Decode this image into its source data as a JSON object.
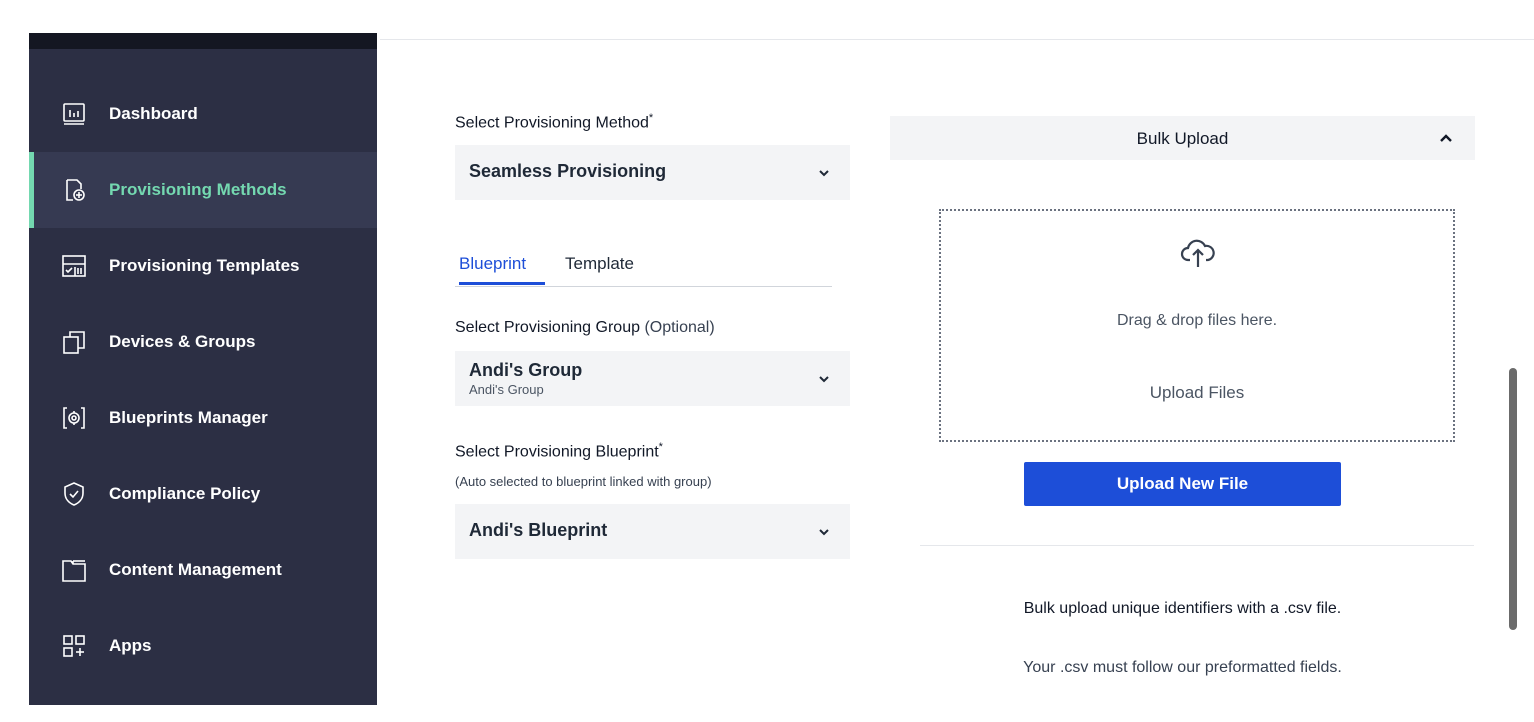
{
  "sidebar": {
    "items": [
      {
        "label": "Dashboard",
        "icon": "dashboard-icon",
        "active": false
      },
      {
        "label": "Provisioning Methods",
        "icon": "provisioning-methods-icon",
        "active": true
      },
      {
        "label": "Provisioning Templates",
        "icon": "templates-icon",
        "active": false
      },
      {
        "label": "Devices & Groups",
        "icon": "devices-icon",
        "active": false
      },
      {
        "label": "Blueprints Manager",
        "icon": "blueprints-icon",
        "active": false
      },
      {
        "label": "Compliance Policy",
        "icon": "shield-check-icon",
        "active": false
      },
      {
        "label": "Content Management",
        "icon": "folder-icon",
        "active": false
      },
      {
        "label": "Apps",
        "icon": "apps-grid-icon",
        "active": false
      }
    ]
  },
  "form": {
    "method_label": "Select Provisioning Method",
    "required_mark": "*",
    "method_value": "Seamless Provisioning",
    "tabs": [
      "Blueprint",
      "Template"
    ],
    "active_tab": "Blueprint",
    "group_label": "Select Provisioning Group",
    "group_optional": "(Optional)",
    "group_value": "Andi's Group",
    "group_sub": "Andi's Group",
    "blueprint_label": "Select Provisioning Blueprint",
    "blueprint_hint": "(Auto selected to blueprint linked with group)",
    "blueprint_value": "Andi's Blueprint"
  },
  "bulk": {
    "header": "Bulk Upload",
    "drag_text": "Drag & drop files here.",
    "upload_files": "Upload Files",
    "upload_button": "Upload New File",
    "info_line1": "Bulk upload unique identifiers with a .csv file.",
    "info_line2": "Your .csv must follow our preformatted fields."
  },
  "colors": {
    "sidebar_bg": "#2c2f44",
    "active_accent": "#74d8b0",
    "primary_blue": "#1d4ed8"
  }
}
